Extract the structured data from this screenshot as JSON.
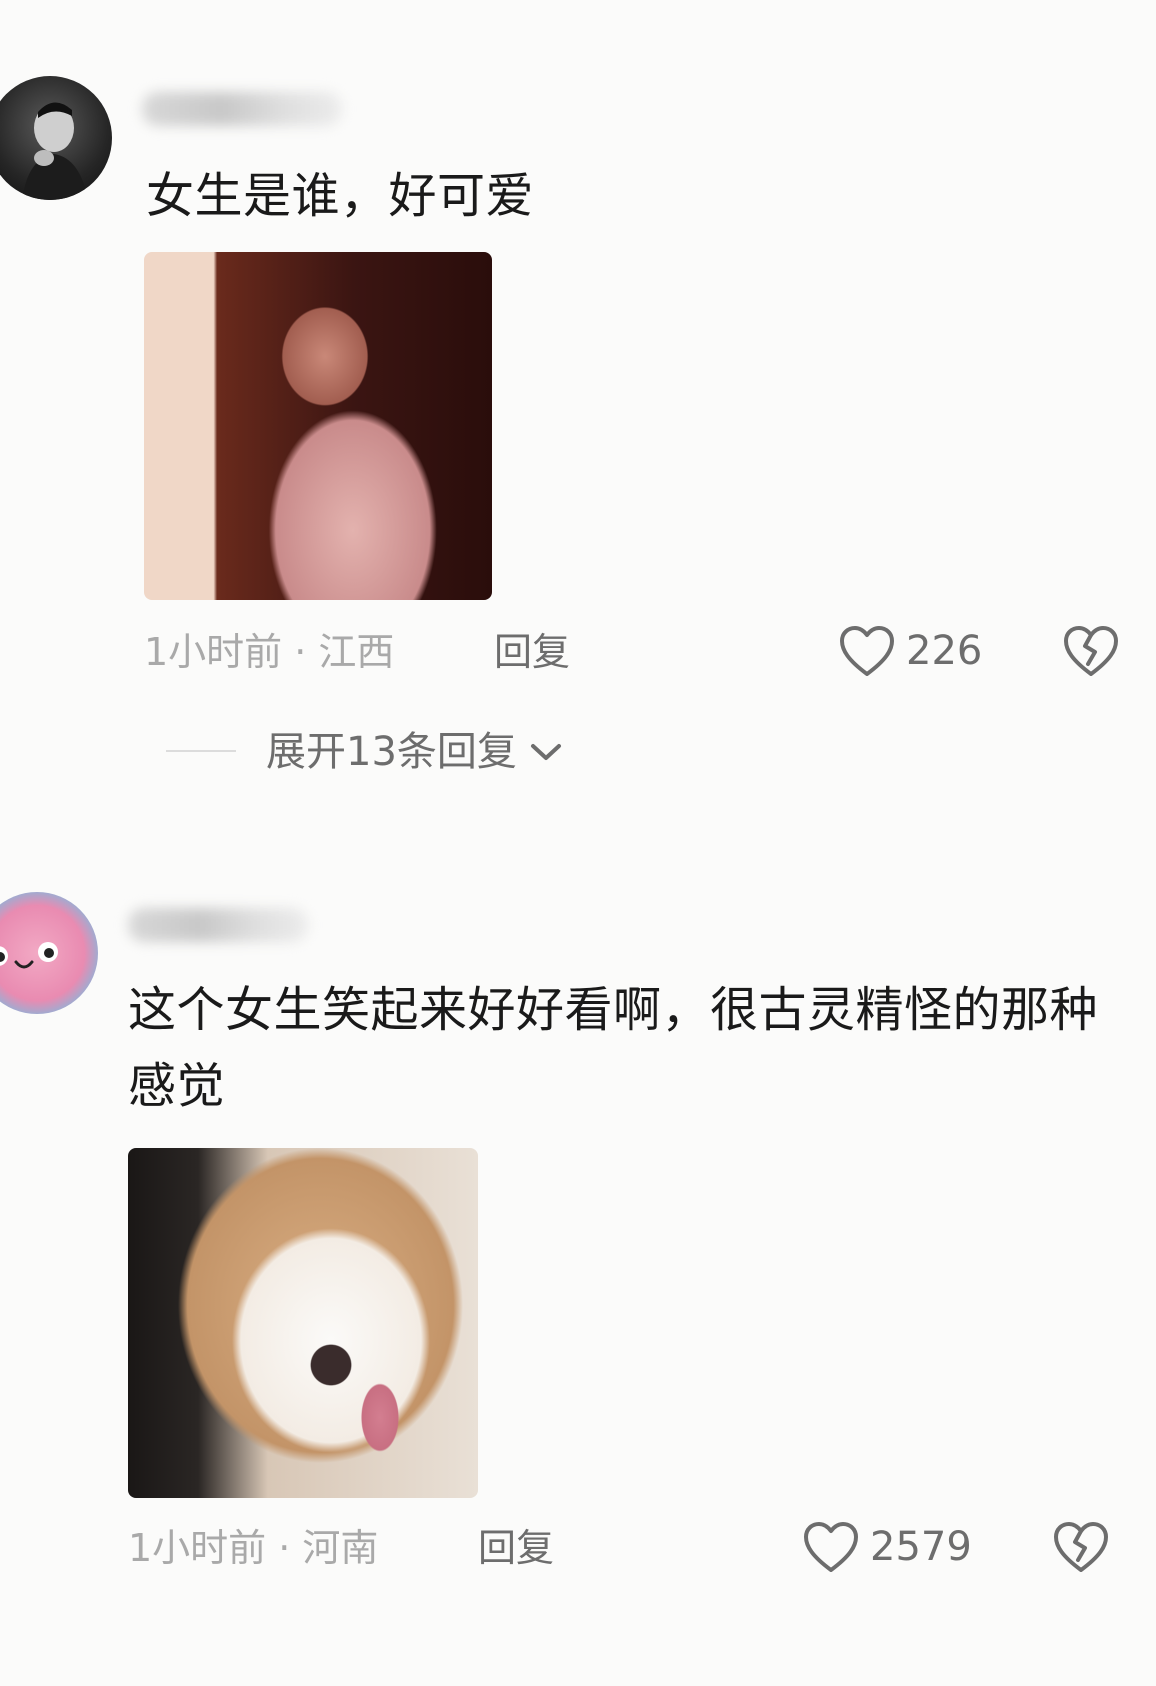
{
  "comments": [
    {
      "text": "女生是谁，好可爱",
      "time_location": "1小时前 · 江西",
      "reply_label": "回复",
      "like_count": "226",
      "expand_replies_label": "展开13条回复"
    },
    {
      "text": "这个女生笑起来好好看啊，很古灵精怪的那种感觉",
      "time_location": "1小时前 · 河南",
      "reply_label": "回复",
      "like_count": "2579"
    }
  ],
  "icons": {
    "like": "heart-outline-icon",
    "dislike": "broken-heart-icon",
    "expand": "chevron-down-icon"
  },
  "colors": {
    "background": "#fbfbfa",
    "text_primary": "#1a1a1a",
    "text_meta": "#a9a9a9",
    "text_action": "#6d6d6d"
  }
}
